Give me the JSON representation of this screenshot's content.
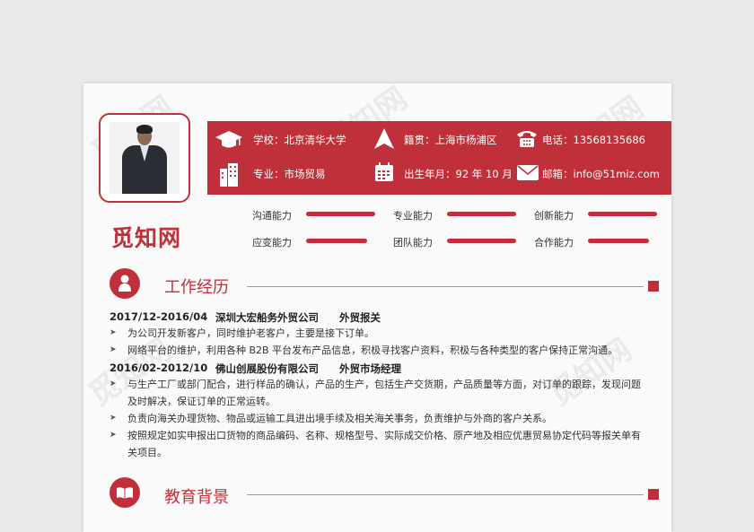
{
  "name": "觅知网",
  "watermark": "觅知网",
  "info": {
    "school": "学校：北京清华大学",
    "origin": "籍贯：上海市杨浦区",
    "phone": "电话：13568135686",
    "major": "专业：市场贸易",
    "birth": "出生年月：92 年 10 月",
    "email": "邮箱：info@51miz.com"
  },
  "skills": [
    {
      "label": "沟通能力",
      "level": 1.0
    },
    {
      "label": "专业能力",
      "level": 1.0
    },
    {
      "label": "创新能力",
      "level": 1.0
    },
    {
      "label": "应变能力",
      "level": 0.88
    },
    {
      "label": "团队能力",
      "level": 1.0
    },
    {
      "label": "合作能力",
      "level": 0.88
    }
  ],
  "work": {
    "title": "工作经历",
    "jobs": [
      {
        "period": "2017/12-2016/04",
        "company": "深圳大宏船务外贸公司",
        "role": "外贸报关",
        "bullets": [
          "为公司开发新客户，同时维护老客户，主要是接下订单。",
          "网络平台的维护，利用各种 B2B 平台发布产品信息，积极寻找客户资料，积极与各种类型的客户保持正常沟通。"
        ]
      },
      {
        "period": "2016/02-2012/10",
        "company": "佛山创展股份有限公司",
        "role": "外贸市场经理",
        "bullets": [
          "与生产工厂或部门配合，进行样品的确认，产品的生产，包括生产交货期，产品质量等方面，对订单的跟踪，发现问题及时解决，保证订单的正常运转。",
          "负责向海关办理货物、物品或运输工具进出境手续及相关海关事务，负责维护与外商的客户关系。",
          "按照规定如实申报出口货物的商品编码、名称、规格型号、实际成交价格、原产地及相应优惠贸易协定代码等报关单有关项目。"
        ]
      }
    ]
  },
  "education": {
    "title": "教育背景"
  },
  "colors": {
    "accent": "#c0303a",
    "background": "#e9e9e9",
    "paper": "#fafafa"
  }
}
